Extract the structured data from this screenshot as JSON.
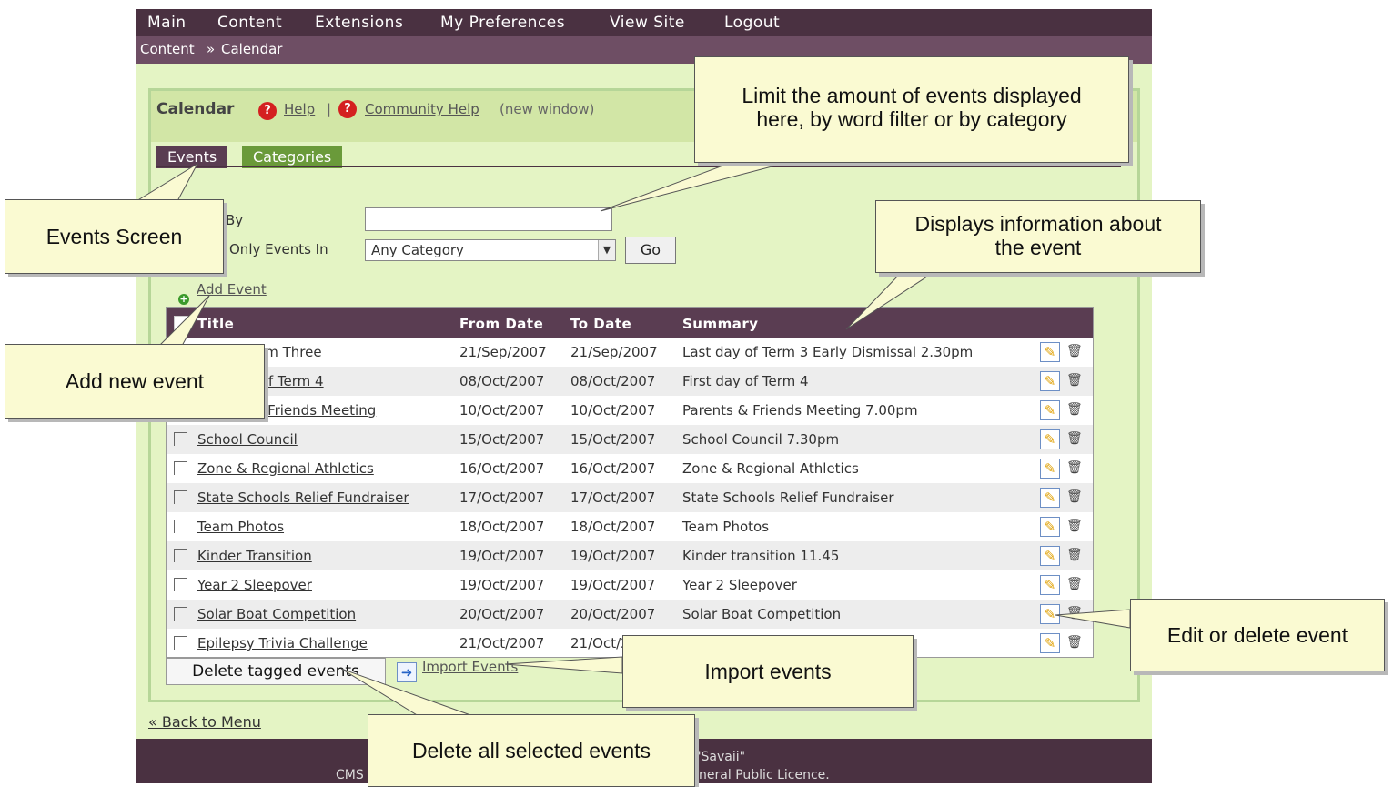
{
  "nav": {
    "items": [
      "Main",
      "Content",
      "Extensions",
      "My Preferences",
      "View Site",
      "Logout"
    ]
  },
  "breadcrumb": {
    "link": "Content",
    "separator": "»",
    "current": "Calendar"
  },
  "module": {
    "title": "Calendar",
    "help": "Help",
    "sep": "|",
    "community_help": "Community Help",
    "new_window": "(new window)"
  },
  "tabs": [
    "Events",
    "Categories"
  ],
  "filter": {
    "label_by": "By",
    "label_show": "Only Events In",
    "value": "",
    "category_selected": "Any Category",
    "go": "Go"
  },
  "add_event": "Add Event",
  "table": {
    "headers": {
      "title": "Title",
      "from": "From Date",
      "to": "To Date",
      "summary": "Summary"
    },
    "rows": [
      {
        "title": "End of Term Three",
        "from": "21/Sep/2007",
        "to": "21/Sep/2007",
        "summary": "Last day of Term 3 Early Dismissal 2.30pm"
      },
      {
        "title": "First day of Term 4",
        "from": "08/Oct/2007",
        "to": "08/Oct/2007",
        "summary": "First day of Term 4"
      },
      {
        "title": "Parents & Friends Meeting",
        "from": "10/Oct/2007",
        "to": "10/Oct/2007",
        "summary": "Parents & Friends Meeting 7.00pm"
      },
      {
        "title": "School Council",
        "from": "15/Oct/2007",
        "to": "15/Oct/2007",
        "summary": "School Council 7.30pm"
      },
      {
        "title": "Zone & Regional Athletics",
        "from": "16/Oct/2007",
        "to": "16/Oct/2007",
        "summary": "Zone & Regional Athletics"
      },
      {
        "title": "State Schools Relief Fundraiser",
        "from": "17/Oct/2007",
        "to": "17/Oct/2007",
        "summary": "State Schools Relief Fundraiser"
      },
      {
        "title": "Team Photos",
        "from": "18/Oct/2007",
        "to": "18/Oct/2007",
        "summary": "Team Photos"
      },
      {
        "title": "Kinder Transition",
        "from": "19/Oct/2007",
        "to": "19/Oct/2007",
        "summary": "Kinder transition 11.45"
      },
      {
        "title": "Year 2 Sleepover",
        "from": "19/Oct/2007",
        "to": "19/Oct/2007",
        "summary": "Year 2 Sleepover"
      },
      {
        "title": "Solar Boat Competition",
        "from": "20/Oct/2007",
        "to": "20/Oct/2007",
        "summary": "Solar Boat Competition"
      },
      {
        "title": "Epilepsy Trivia Challenge",
        "from": "21/Oct/2007",
        "to": "21/Oct/2007",
        "summary": "Epilepsy Trivia Challenge"
      }
    ]
  },
  "actions": {
    "delete_tagged": "Delete tagged events",
    "import": "Import Events"
  },
  "back_to_menu": "« Back to Menu",
  "footer": {
    "line1": "1.1.2 \"Savaii\"",
    "line2": "CMS Made Simple is free software released under the General Public Licence."
  },
  "callouts": {
    "limit_events": [
      "Limit the amount of events displayed",
      "here, by word filter or by category"
    ],
    "events_screen": "Events Screen",
    "displays_info": [
      "Displays information about",
      "the event"
    ],
    "add_new_event": "Add new event",
    "edit_delete": "Edit or delete event",
    "import_events": "Import events",
    "delete_selected": "Delete all selected events"
  },
  "icons": {
    "help": "help-icon",
    "edit": "edit-pencil-icon",
    "delete": "trash-icon",
    "add": "add-plus-icon",
    "import": "import-arrow-icon"
  },
  "colors": {
    "nav_bg": "#4a3141",
    "crumb_bg": "#6e4e64",
    "page_bg": "#e4f4c4",
    "tab_active": "#5a3d52",
    "tab_inactive": "#6a9a3a",
    "callout_bg": "#fafad2"
  }
}
